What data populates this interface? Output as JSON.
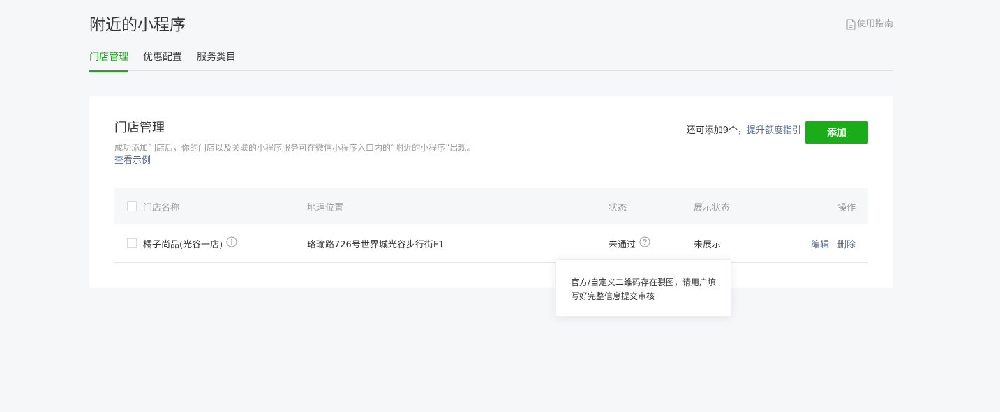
{
  "header": {
    "title": "附近的小程序",
    "guide_link": "使用指南"
  },
  "tabs": [
    {
      "label": "门店管理",
      "active": true
    },
    {
      "label": "优惠配置",
      "active": false
    },
    {
      "label": "服务类目",
      "active": false
    }
  ],
  "card": {
    "title": "门店管理",
    "description": "成功添加门店后，你的门店以及关联的小程序服务可在微信小程序入口内的“附近的小程序”出现。",
    "example_link": "查看示例",
    "quota_text": "还可添加9个，",
    "quota_link": "提升额度指引",
    "add_button": "添加"
  },
  "table": {
    "columns": [
      "门店名称",
      "地理位置",
      "状态",
      "展示状态",
      "操作"
    ],
    "rows": [
      {
        "name": "橘子尚品(光谷一店)",
        "location": "珞瑜路726号世界城光谷步行街F1",
        "status": "未通过",
        "display_status": "未展示",
        "actions": [
          "编辑",
          "删除"
        ]
      }
    ]
  },
  "tooltip": {
    "text": "官方/自定义二维码存在裂图，请用户填写好完整信息提交审核"
  },
  "colors": {
    "accent": "#1aad19",
    "link": "#576b95",
    "muted": "#9a9a9a",
    "background": "#f6f7f9"
  }
}
